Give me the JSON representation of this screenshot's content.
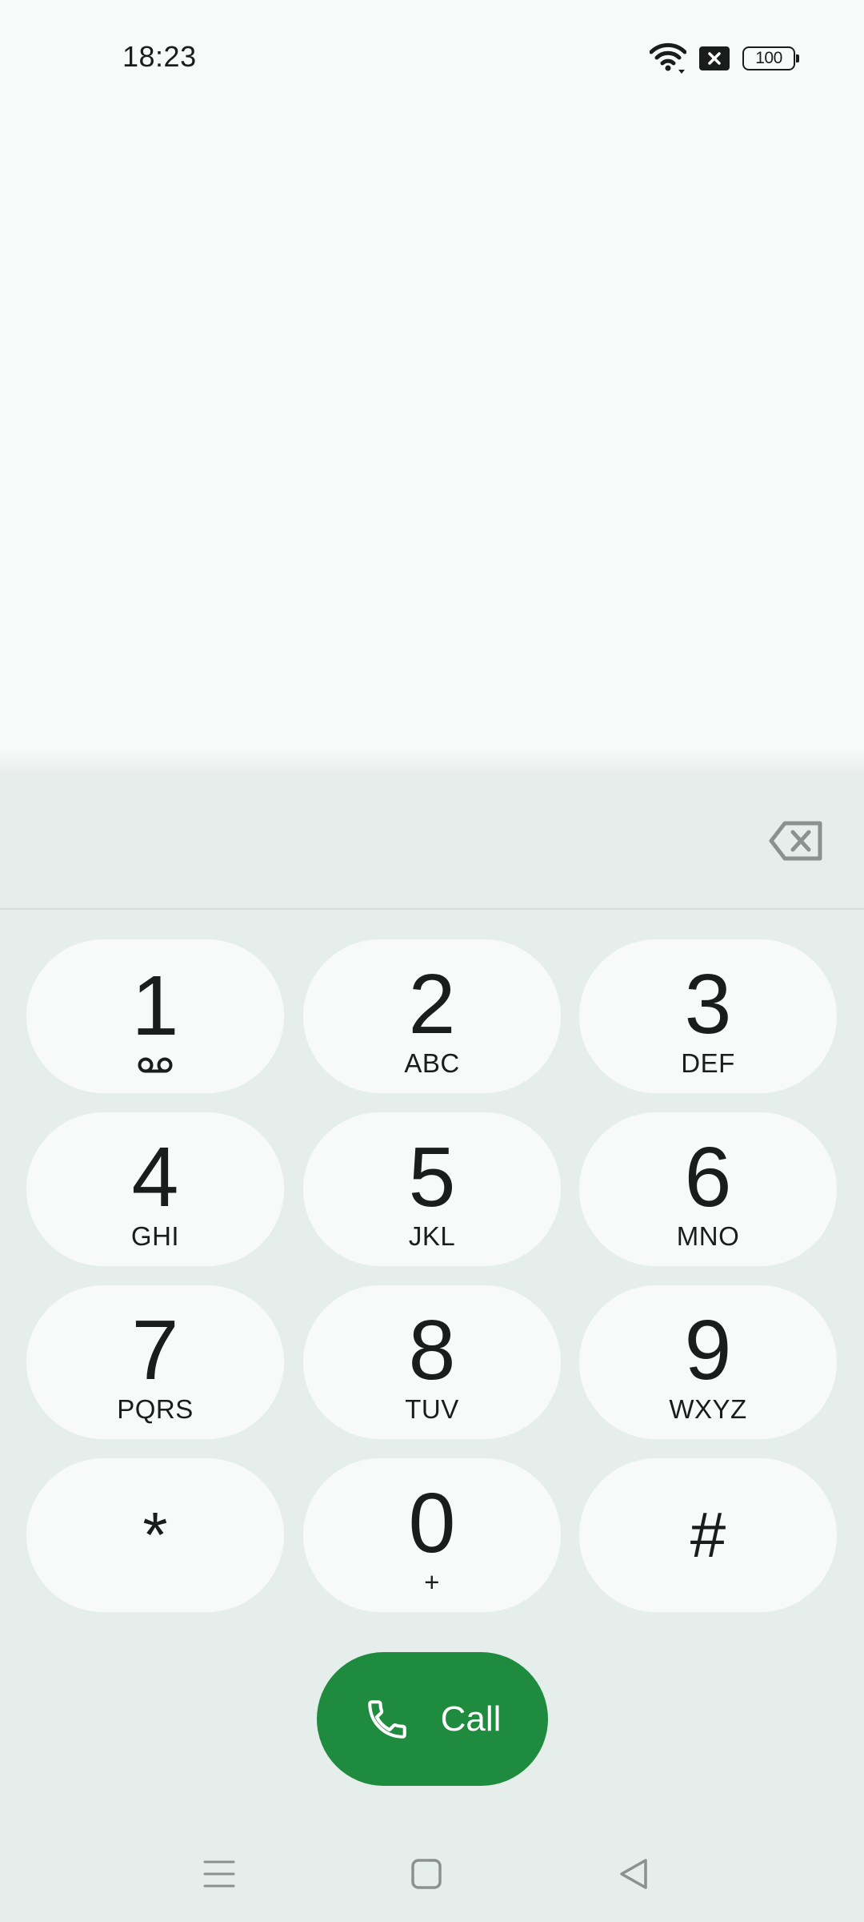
{
  "status_bar": {
    "time": "18:23",
    "icons": [
      "wifi-icon",
      "no-sim-icon",
      "battery-icon"
    ],
    "battery_level": "100"
  },
  "dialer": {
    "digits_value": "",
    "backspace_icon": "backspace-icon",
    "keys": [
      {
        "digit": "1",
        "letters": "",
        "icon": "voicemail-icon"
      },
      {
        "digit": "2",
        "letters": "ABC"
      },
      {
        "digit": "3",
        "letters": "DEF"
      },
      {
        "digit": "4",
        "letters": "GHI"
      },
      {
        "digit": "5",
        "letters": "JKL"
      },
      {
        "digit": "6",
        "letters": "MNO"
      },
      {
        "digit": "7",
        "letters": "PQRS"
      },
      {
        "digit": "8",
        "letters": "TUV"
      },
      {
        "digit": "9",
        "letters": "WXYZ"
      },
      {
        "digit": "*",
        "letters": ""
      },
      {
        "digit": "0",
        "letters": "+"
      },
      {
        "digit": "#",
        "letters": ""
      }
    ],
    "call_button": {
      "label": "Call",
      "icon": "phone-icon",
      "color": "#1f8b3e"
    }
  },
  "nav_bar": {
    "icons": [
      "menu-icon",
      "home-icon",
      "back-icon"
    ]
  },
  "colors": {
    "background": "#f8faf9",
    "dialpad_background": "#e6eeec",
    "key_background": "#f8faf9",
    "accent_green": "#1f8b3e"
  }
}
